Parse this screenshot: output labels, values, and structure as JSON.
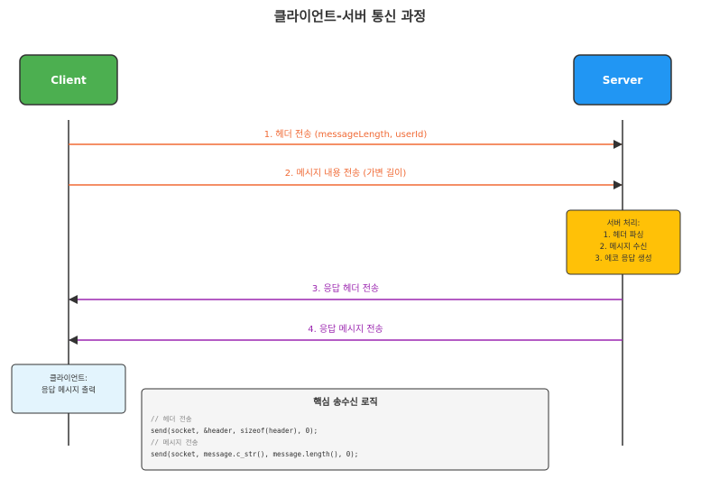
{
  "title": "클라이언트-서버 통신 과정",
  "actors": {
    "client": {
      "label": "Client",
      "color": "#4caf50"
    },
    "server": {
      "label": "Server",
      "color": "#2196f3"
    }
  },
  "messages": [
    {
      "label": "1. 헤더 전송 (messageLength, userId)",
      "from": "client",
      "to": "server",
      "color": "#f06a35"
    },
    {
      "label": "2. 메시지 내용 전송 (가변 길이)",
      "from": "client",
      "to": "server",
      "color": "#f06a35"
    },
    {
      "label": "3. 응답 헤더 전송",
      "from": "server",
      "to": "client",
      "color": "#9c27b0"
    },
    {
      "label": "4. 응답 메시지 전송",
      "from": "server",
      "to": "client",
      "color": "#9c27b0"
    }
  ],
  "server_note": {
    "lines": [
      "서버 처리:",
      "1. 헤더 파싱",
      "2. 메시지 수신",
      "3. 에코 응답 생성"
    ],
    "color": "#ffc107"
  },
  "client_note": {
    "lines": [
      "클라이언트:",
      "응답 메시지 출력"
    ],
    "color": "#e3f4fd"
  },
  "code_box": {
    "title": "핵심 송수신 로직",
    "lines": [
      "// 헤더 전송",
      "send(socket, &header, sizeof(header), 0);",
      "// 메시지 전송",
      "send(socket, message.c_str(), message.length(), 0);"
    ],
    "comment_color": "#888888",
    "code_color": "#333333"
  }
}
